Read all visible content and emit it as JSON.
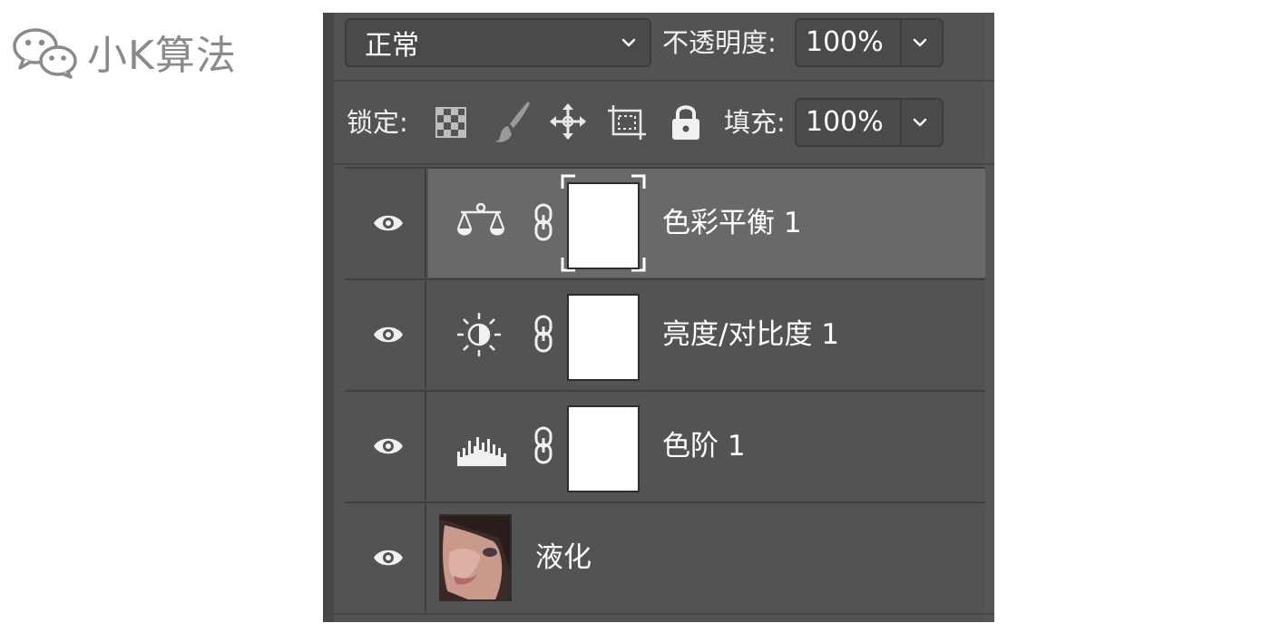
{
  "watermark": {
    "text": "小K算法",
    "icon": "wechat-icon"
  },
  "panel": {
    "blend_mode": "正常",
    "opacity_label": "不透明度:",
    "opacity_value": "100%",
    "lock_label": "锁定:",
    "lock_icons": [
      "lock-transparent-pixels-icon",
      "lock-image-pixels-icon",
      "lock-position-icon",
      "lock-artboard-icon",
      "lock-all-icon"
    ],
    "fill_label": "填充:",
    "fill_value": "100%"
  },
  "layers": [
    {
      "name": "色彩平衡 1",
      "type": "adjustment",
      "icon": "color-balance-icon",
      "selected": true
    },
    {
      "name": "亮度/对比度 1",
      "type": "adjustment",
      "icon": "brightness-contrast-icon",
      "selected": false
    },
    {
      "name": "色阶 1",
      "type": "adjustment",
      "icon": "levels-icon",
      "selected": false
    },
    {
      "name": "液化",
      "type": "pixel",
      "icon": "layer-thumbnail",
      "selected": false
    }
  ],
  "colors": {
    "panel_bg": "#535353",
    "selected_row": "#696969",
    "text": "#ffffff"
  }
}
